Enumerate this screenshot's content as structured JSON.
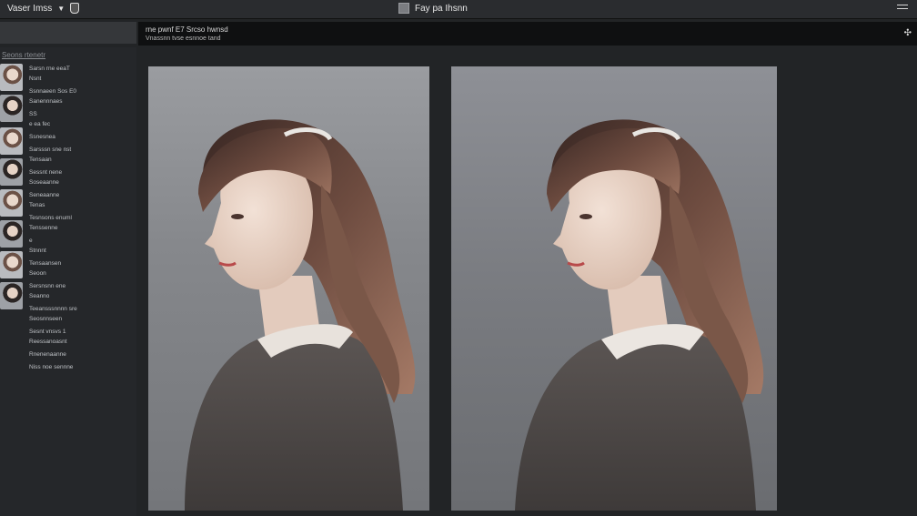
{
  "topbar": {
    "left_label": "Vaser Imss",
    "center_label": "Fay pa Ihsnn",
    "icons": [
      "caret-down-icon",
      "shield-icon",
      "square-icon",
      "menu-icon"
    ]
  },
  "infobar": {
    "line1": "rne pwnf E7 Srcso hwnsd",
    "line2": "Vnassnn tvse esnnoe tand",
    "action_icon": "expand-icon"
  },
  "sidebar": {
    "header": "Seons rtenetr",
    "items": [
      {
        "lines": [
          "Sarsn rne eeaT",
          "Nsnt"
        ]
      },
      {
        "lines": [
          "Ssnnaeen Sos E0",
          "Sanennnaes"
        ]
      },
      {
        "lines": [
          "SS",
          "e ea fec"
        ]
      },
      {
        "lines": [
          "Ssnesnea"
        ]
      },
      {
        "lines": [
          "Sarsssn sne nst",
          "Tensaan"
        ]
      },
      {
        "lines": [
          "Sessnt nene",
          "Soseaanne"
        ]
      },
      {
        "lines": [
          "Seneaanne",
          "Tenas"
        ]
      },
      {
        "lines": [
          "Tesnsons enuml",
          "Tenssenne"
        ]
      },
      {
        "lines": [
          "e",
          "Stnnnt"
        ]
      },
      {
        "lines": [
          "Tensaansen",
          "Seoon"
        ]
      },
      {
        "lines": [
          "Sersnsnn ene",
          "Seanno"
        ]
      },
      {
        "lines": [
          "Teeansssnnnn sre",
          "Seosnnseen"
        ]
      },
      {
        "lines": [
          "Sesnt vnsvs 1",
          "Reessanoasnt"
        ]
      },
      {
        "lines": [
          "Rnenenaanne"
        ]
      },
      {
        "lines": [
          "Niss noe sennne"
        ]
      }
    ]
  },
  "images": [
    {
      "alt": "portrait-left"
    },
    {
      "alt": "portrait-right"
    }
  ]
}
